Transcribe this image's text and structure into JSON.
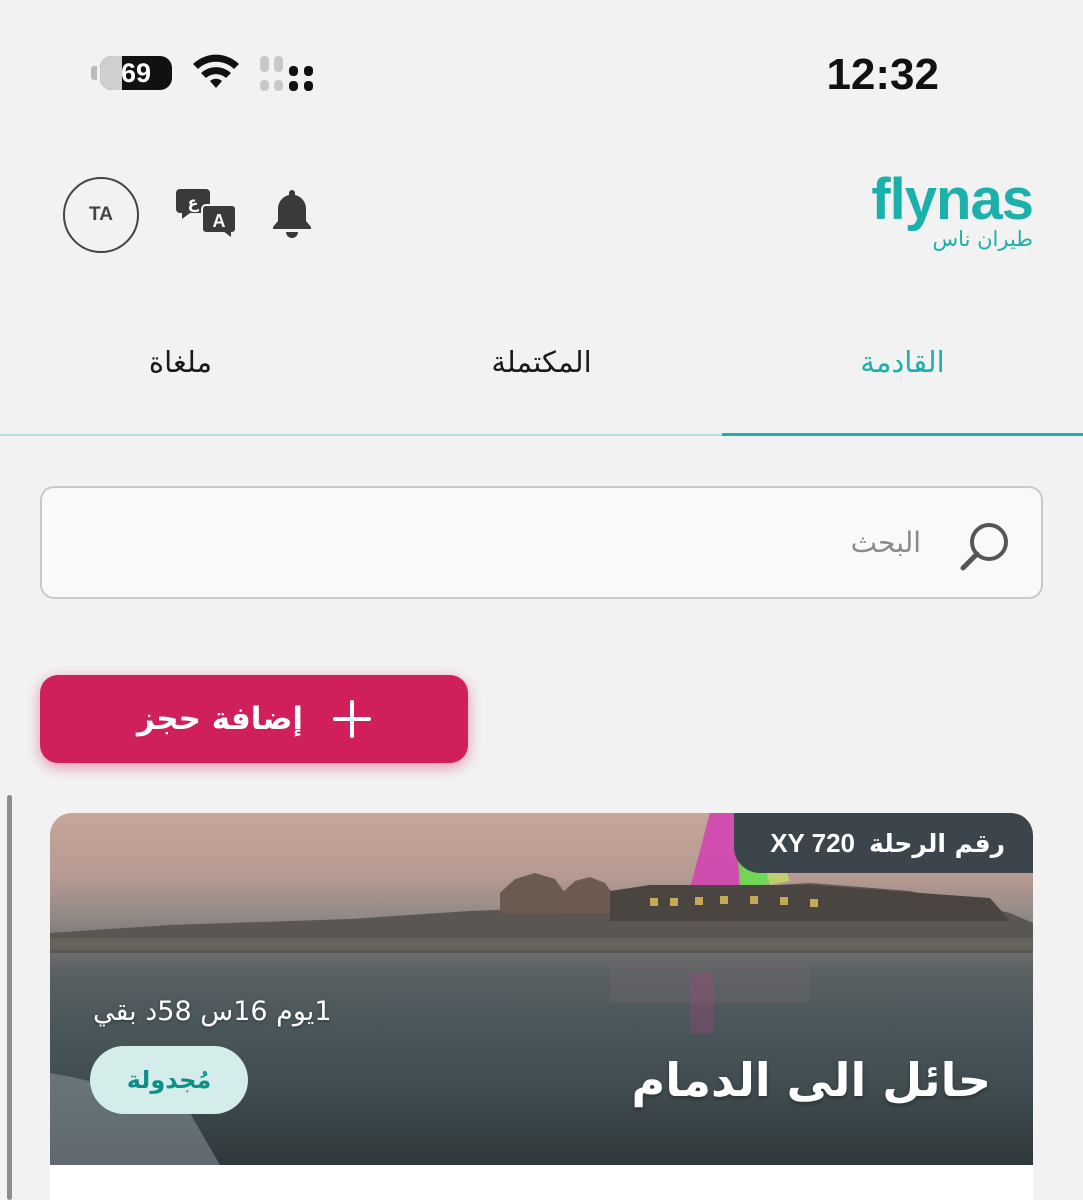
{
  "status_bar": {
    "battery": "69",
    "time": "12:32"
  },
  "header": {
    "avatar_initials": "TA",
    "logo_latin": "flynas",
    "logo_arabic": "طيران ناس"
  },
  "tabs": [
    {
      "label": "القادمة",
      "active": true
    },
    {
      "label": "المكتملة",
      "active": false
    },
    {
      "label": "ملغاة",
      "active": false
    }
  ],
  "search": {
    "placeholder": "البحث",
    "value": ""
  },
  "add_booking": {
    "label": "إضافة حجز"
  },
  "booking_card": {
    "flight_label": "رقم الرحلة",
    "flight_number": "XY 720",
    "time_remaining": "1يوم 16س 58د بقي",
    "status": "مُجدولة",
    "route": "حائل الى الدمام"
  },
  "colors": {
    "brand_teal": "#1bb0a9",
    "primary_button": "#d0205c",
    "status_pill_bg": "#d4ecea",
    "badge_bg": "#3b454b"
  }
}
